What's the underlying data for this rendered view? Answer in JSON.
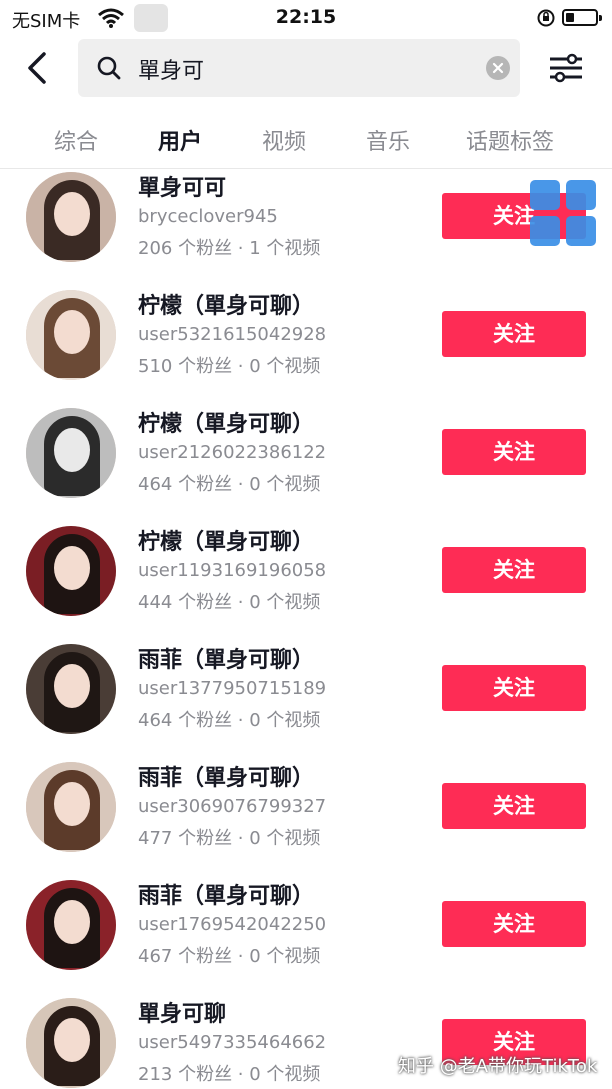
{
  "status_bar": {
    "carrier": "无SIM卡",
    "time": "22:15"
  },
  "search": {
    "query": "單身可"
  },
  "tabs": [
    {
      "label": "综合",
      "active": false
    },
    {
      "label": "用户",
      "active": true
    },
    {
      "label": "视频",
      "active": false
    },
    {
      "label": "音乐",
      "active": false
    },
    {
      "label": "话题标签",
      "active": false
    }
  ],
  "users": [
    {
      "name": "單身可可",
      "id": "bryceclover945",
      "stats": "206 个粉丝 · 1 个视频",
      "follow_label": "关注"
    },
    {
      "name": "柠檬（單身可聊）",
      "id": "user5321615042928",
      "stats": "510 个粉丝 · 0 个视频",
      "follow_label": "关注"
    },
    {
      "name": "柠檬（單身可聊）",
      "id": "user2126022386122",
      "stats": "464 个粉丝 · 0 个视频",
      "follow_label": "关注"
    },
    {
      "name": "柠檬（單身可聊）",
      "id": "user1193169196058",
      "stats": "444 个粉丝 · 0 个视频",
      "follow_label": "关注"
    },
    {
      "name": "雨菲（單身可聊）",
      "id": "user1377950715189",
      "stats": "464 个粉丝 · 0 个视频",
      "follow_label": "关注"
    },
    {
      "name": "雨菲（單身可聊）",
      "id": "user3069076799327",
      "stats": "477 个粉丝 · 0 个视频",
      "follow_label": "关注"
    },
    {
      "name": "雨菲（單身可聊）",
      "id": "user1769542042250",
      "stats": "467 个粉丝 · 0 个视频",
      "follow_label": "关注"
    },
    {
      "name": "單身可聊",
      "id": "user5497335464662",
      "stats": "213 个粉丝 · 0 个视频",
      "follow_label": "关注"
    }
  ],
  "watermark": "知乎 @老A带你玩TikTok",
  "colors": {
    "accent": "#fe2c55",
    "muted_text": "#8a8b91",
    "primary_text": "#161823"
  }
}
